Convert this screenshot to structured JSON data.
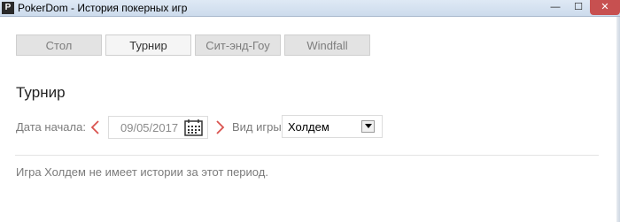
{
  "window": {
    "app_icon_text": "P",
    "title": "PokerDom - История покерных игр",
    "minimize": "—",
    "maximize": "☐",
    "close": "✕"
  },
  "tabs": [
    {
      "label": "Стол",
      "active": false
    },
    {
      "label": "Турнир",
      "active": true
    },
    {
      "label": "Сит-энд-Гоу",
      "active": false
    },
    {
      "label": "Windfall",
      "active": false
    }
  ],
  "section": {
    "title": "Турнир"
  },
  "filters": {
    "start_date_label": "Дата начала:",
    "start_date_value": "09/05/2017",
    "game_type_label": "Вид игры:",
    "game_type_value": "Холдем"
  },
  "message": "Игра Холдем не имеет истории за этот период.",
  "colors": {
    "arrow": "#d9534f",
    "tab_bg": "#e3e3e3",
    "tab_active_bg": "#f5f5f5"
  }
}
